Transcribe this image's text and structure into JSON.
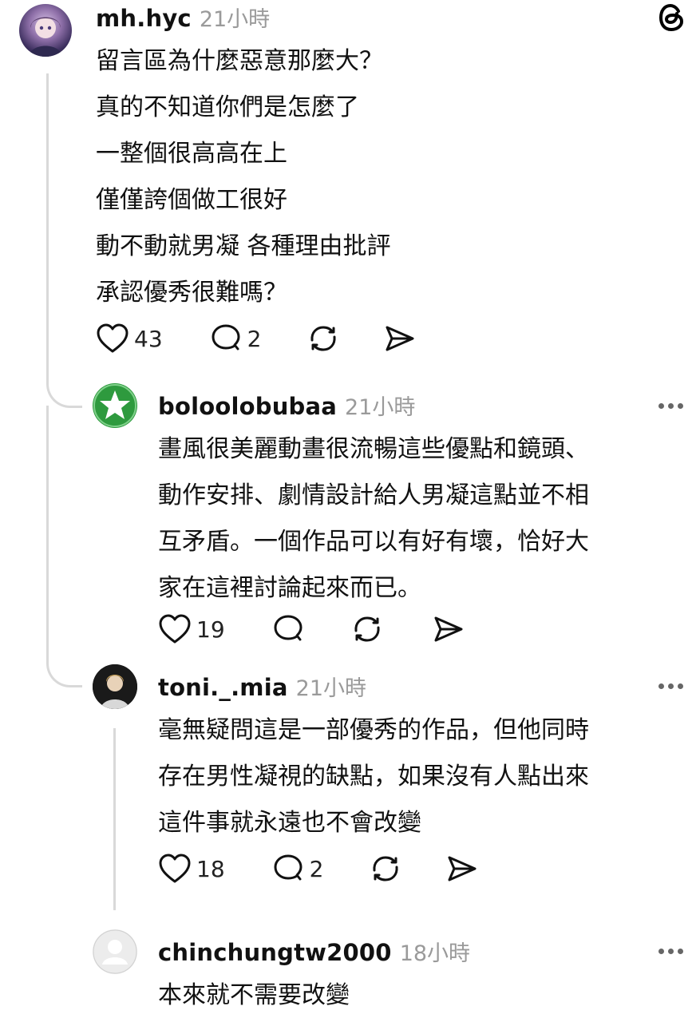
{
  "app": {
    "logo_icon": "threads-logo-icon"
  },
  "comments": [
    {
      "username": "mh.hyc",
      "time": "21小時",
      "lines": [
        "留言區為什麼惡意那麼大？",
        "真的不知道你們是怎麼了",
        "一整個很高高在上",
        "僅僅誇個做工很好",
        "動不動就男凝 各種理由批評",
        "承認優秀很難嗎？"
      ],
      "likes": "43",
      "replies": "2"
    },
    {
      "username": "boloolobubaa",
      "time": "21小時",
      "lines": [
        "畫風很美麗動畫很流暢這些優點和鏡頭、",
        "動作安排、劇情設計給人男凝這點並不相",
        "互矛盾。一個作品可以有好有壞，恰好大",
        "家在這裡討論起來而已。"
      ],
      "likes": "19",
      "replies": ""
    },
    {
      "username": "toni._.mia",
      "time": "21小時",
      "lines": [
        "毫無疑問這是一部優秀的作品，但他同時",
        "存在男性凝視的缺點，如果沒有人點出來",
        "這件事就永遠也不會改變"
      ],
      "likes": "18",
      "replies": "2"
    },
    {
      "username": "chinchungtw2000",
      "time": "18小時",
      "lines": [
        "本來就不需要改變"
      ]
    }
  ],
  "icons": {
    "like": "heart-icon",
    "reply": "comment-bubble-icon",
    "repost": "repost-icon",
    "share": "send-icon",
    "more": "more-dots-icon"
  },
  "colors": {
    "accent_green": "#2e9a3e",
    "meta_gray": "#9a9a9a"
  }
}
